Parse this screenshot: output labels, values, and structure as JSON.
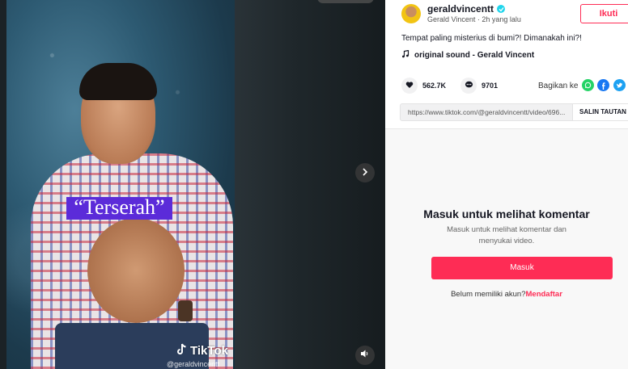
{
  "video": {
    "caption": "“Terserah”",
    "watermark_brand": "TikTok",
    "watermark_handle": "@geraldvincentt",
    "next_icon": "chevron-right-icon",
    "volume_icon": "volume-icon"
  },
  "author": {
    "username": "geraldvincentt",
    "display_name": "Gerald Vincent",
    "time_ago": "2h yang lalu",
    "separator": " · ",
    "follow_label": "Ikuti",
    "verified_icon": "verified-badge-icon"
  },
  "post": {
    "description": "Tempat paling misterius di bumi?! Dimanakah ini?!",
    "sound_label": "original sound - Gerald Vincent"
  },
  "stats": {
    "likes": "562.7K",
    "comments": "9701",
    "share_label": "Bagikan ke"
  },
  "share_targets": [
    "whatsapp-icon",
    "facebook-icon",
    "twitter-icon"
  ],
  "link": {
    "url": "https://www.tiktok.com/@geraldvincentt/video/696...",
    "copy_label": "SALIN TAUTAN"
  },
  "comments_login": {
    "title": "Masuk untuk melihat komentar",
    "subtitle": "Masuk untuk melihat komentar dan menyukai video.",
    "login_button": "Masuk",
    "signup_prompt": "Belum memiliki akun?",
    "signup_link": "Mendaftar"
  },
  "colors": {
    "accent": "#fe2c55",
    "caption_bg": "#5b2bd9",
    "whatsapp": "#25d366",
    "facebook": "#1877f2",
    "twitter": "#1da1f2"
  }
}
